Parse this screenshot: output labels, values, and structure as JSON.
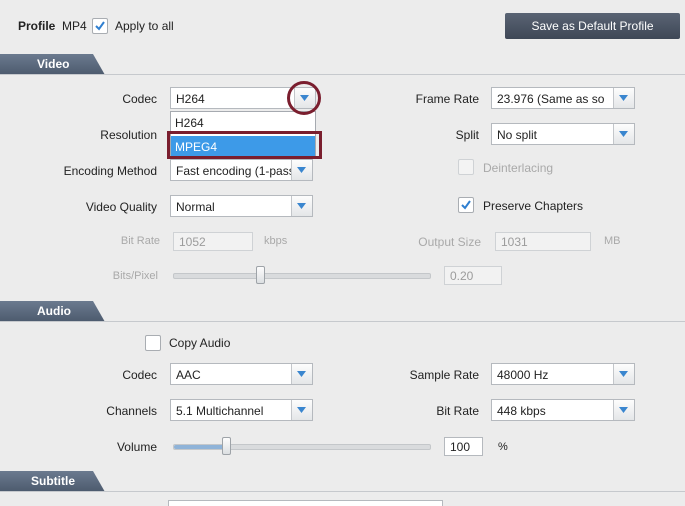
{
  "profile": {
    "label": "Profile",
    "format": "MP4",
    "apply_to_all_label": "Apply to all",
    "apply_to_all_checked": true,
    "save_default_label": "Save as Default Profile"
  },
  "video": {
    "section_label": "Video",
    "codec": {
      "label": "Codec",
      "value": "H264",
      "options": [
        "H264",
        "MPEG4"
      ],
      "highlighted_option": "MPEG4"
    },
    "resolution": {
      "label": "Resolution"
    },
    "encoding_method": {
      "label": "Encoding Method",
      "value": "Fast encoding (1-pass"
    },
    "video_quality": {
      "label": "Video Quality",
      "value": "Normal"
    },
    "bit_rate": {
      "label": "Bit Rate",
      "value": "1052",
      "unit": "kbps"
    },
    "bits_per_pixel": {
      "label": "Bits/Pixel",
      "value": "0.20",
      "slider_fraction": 0.34
    },
    "frame_rate": {
      "label": "Frame Rate",
      "value": "23.976 (Same as so"
    },
    "split": {
      "label": "Split",
      "value": "No split"
    },
    "deinterlacing": {
      "label": "Deinterlacing",
      "checked": false
    },
    "preserve_chapters": {
      "label": "Preserve Chapters",
      "checked": true
    },
    "output_size": {
      "label": "Output Size",
      "value": "1031",
      "unit": "MB"
    }
  },
  "audio": {
    "section_label": "Audio",
    "copy_audio": {
      "label": "Copy Audio",
      "checked": false
    },
    "codec": {
      "label": "Codec",
      "value": "AAC"
    },
    "channels": {
      "label": "Channels",
      "value": "5.1 Multichannel"
    },
    "volume": {
      "label": "Volume",
      "value": "100",
      "unit": "%",
      "slider_fraction": 0.21
    },
    "sample_rate": {
      "label": "Sample Rate",
      "value": "48000 Hz"
    },
    "bit_rate": {
      "label": "Bit Rate",
      "value": "448 kbps"
    }
  },
  "subtitle": {
    "section_label": "Subtitle"
  },
  "colors": {
    "section_tab": "#5b697c",
    "selection": "#3d9ae8",
    "annotation": "#7a1e2e"
  }
}
